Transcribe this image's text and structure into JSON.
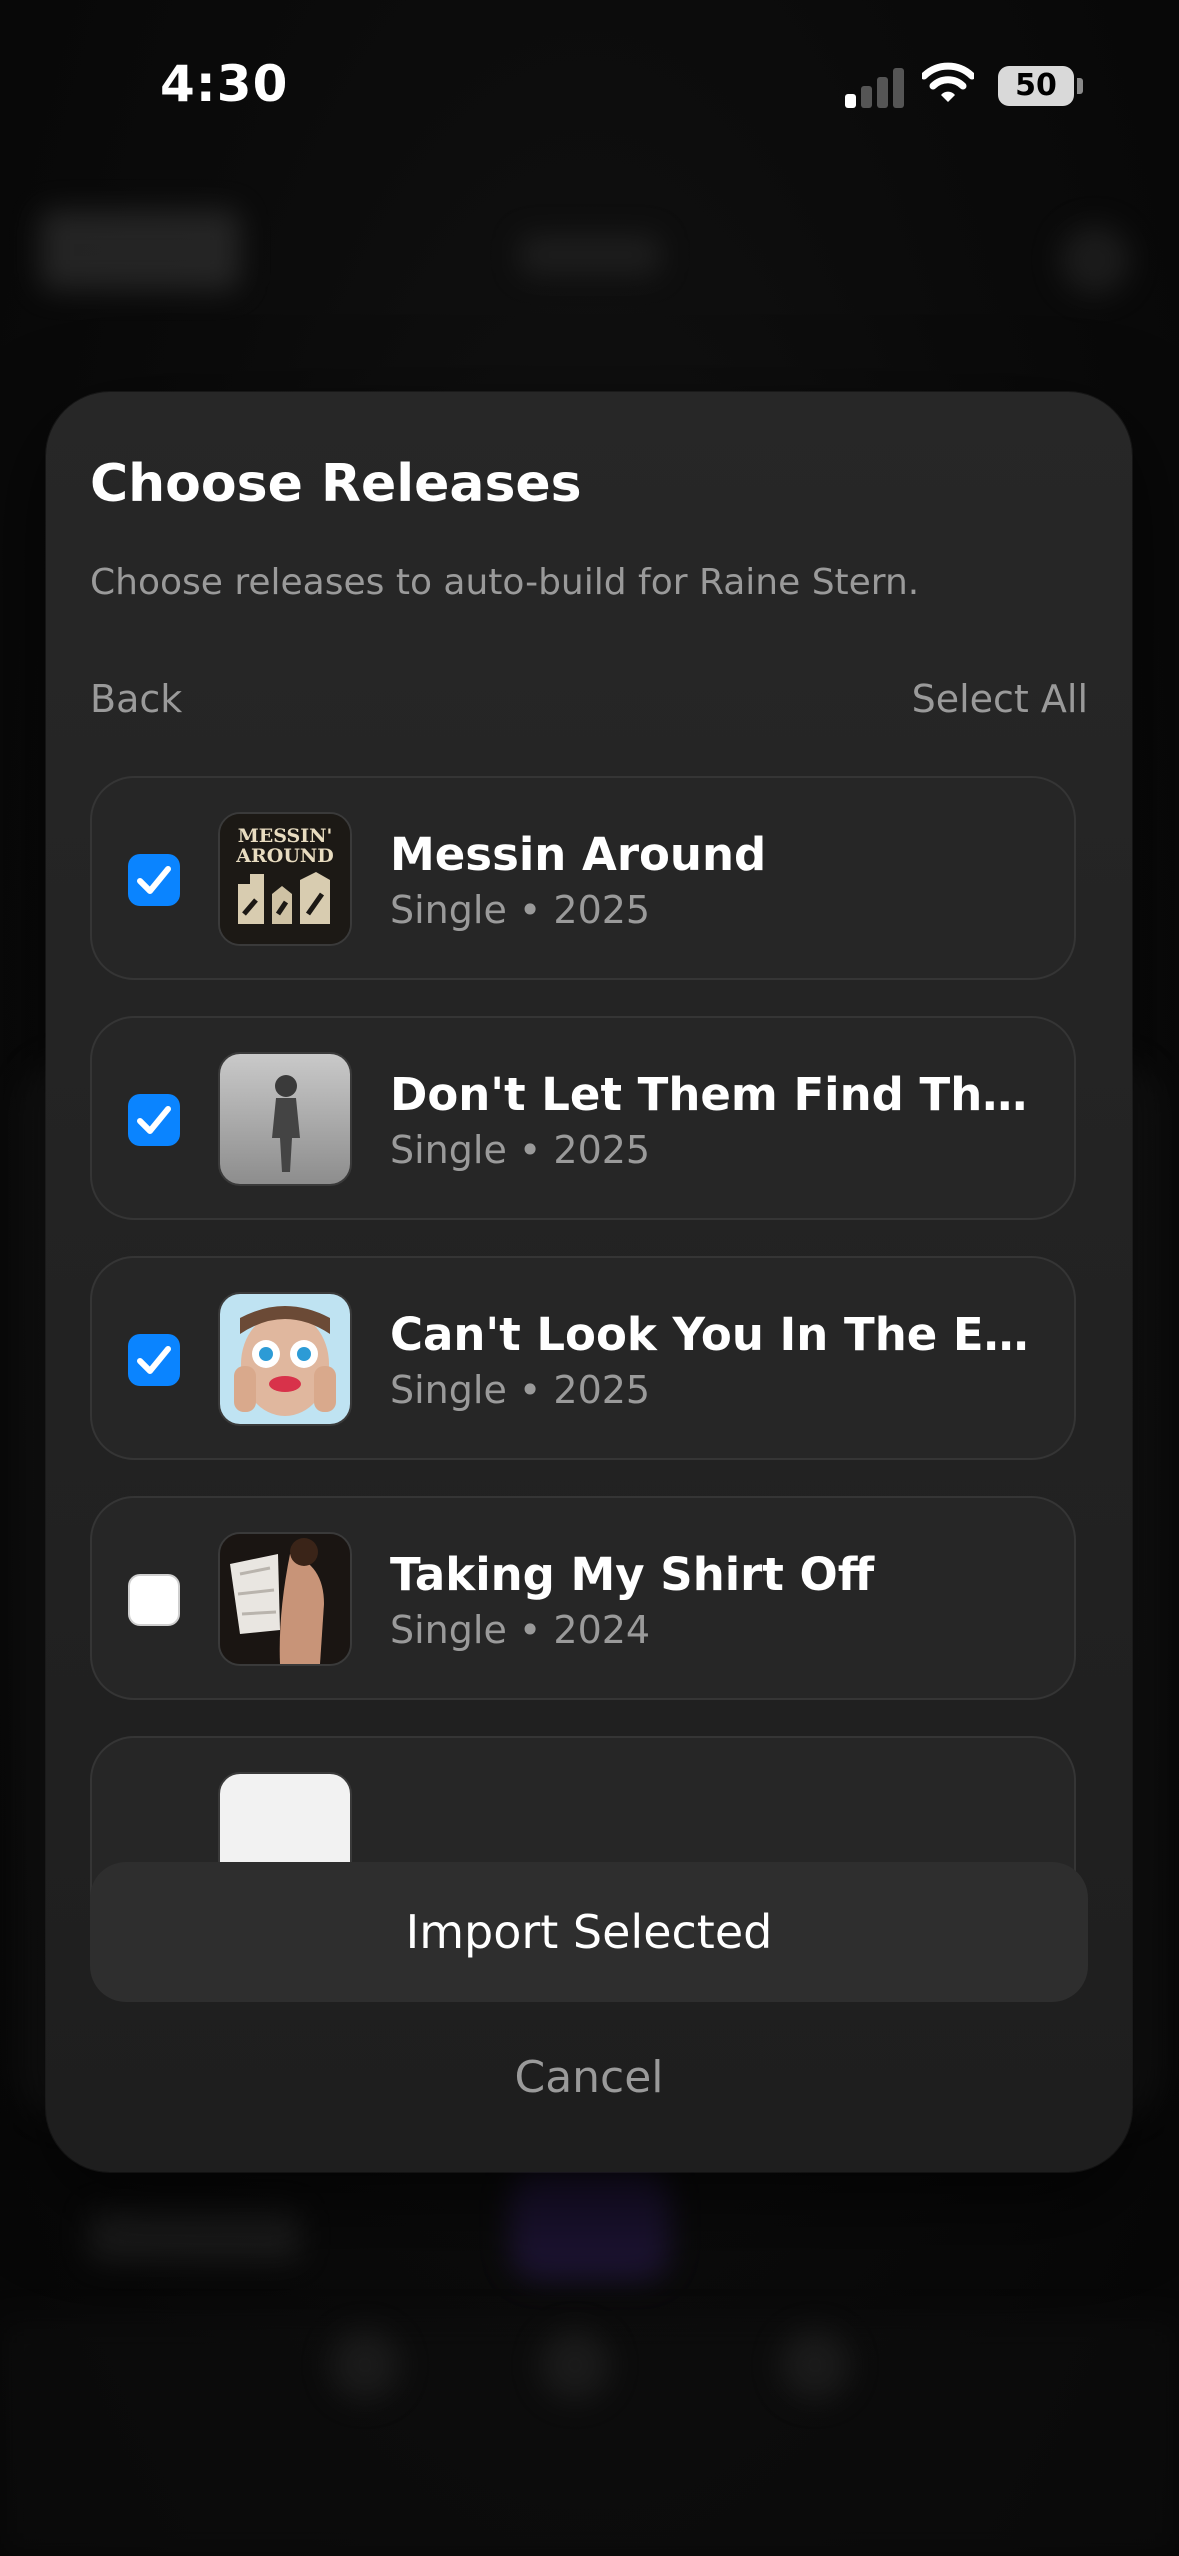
{
  "status_bar": {
    "time": "4:30",
    "battery_percent": "50",
    "signal_bars_active": 1,
    "signal_bars_total": 4
  },
  "sheet": {
    "title": "Choose Releases",
    "subtitle": "Choose releases to auto-build for Raine Stern.",
    "back_label": "Back",
    "select_all_label": "Select All",
    "import_label": "Import Selected",
    "cancel_label": "Cancel"
  },
  "releases": [
    {
      "title": "Messin Around",
      "meta": "Single • 2025",
      "checked": true,
      "art_text": "MESSIN' AROUND"
    },
    {
      "title": "Don't Let Them Find The Int…",
      "meta": "Single • 2025",
      "checked": true,
      "art_text": ""
    },
    {
      "title": "Can't Look You In The Eyes",
      "meta": "Single • 2025",
      "checked": true,
      "art_text": ""
    },
    {
      "title": "Taking My Shirt Off",
      "meta": "Single • 2024",
      "checked": false,
      "art_text": ""
    }
  ],
  "colors": {
    "accent": "#0a84ff",
    "sheet_bg": "#232323",
    "row_bg": "#262626",
    "secondary_text": "#9a9a9a"
  },
  "icons": {
    "check": "checkmark-icon",
    "wifi": "wifi-icon",
    "signal": "cellular-signal-icon",
    "battery": "battery-icon"
  }
}
